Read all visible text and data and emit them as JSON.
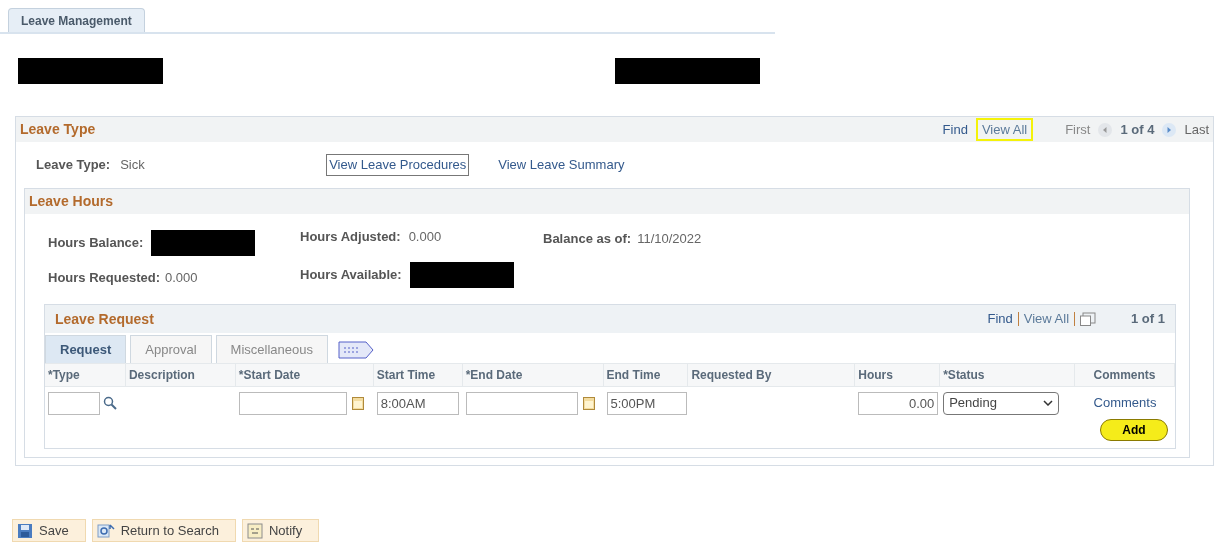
{
  "page_tab": {
    "label": "Leave Management",
    "selected": true
  },
  "leave_type_panel": {
    "title": "Leave Type",
    "nav": {
      "find": "Find",
      "view_all": {
        "label": "View All",
        "highlighted": true
      },
      "first": "First",
      "position": "1 of 4",
      "last": "Last"
    },
    "fields": {
      "leave_type_label": "Leave Type:",
      "leave_type_value": "Sick"
    },
    "links": [
      {
        "label": "View Leave Procedures",
        "focused": true
      },
      {
        "label": "View Leave Summary",
        "focused": false
      }
    ]
  },
  "leave_hours_panel": {
    "title": "Leave Hours",
    "hours_balance_label": "Hours Balance:",
    "hours_requested_label": "Hours Requested:",
    "hours_requested": "0.000",
    "hours_adjusted_label": "Hours Adjusted:",
    "hours_adjusted": "0.000",
    "hours_available_label": "Hours Available:",
    "balance_as_of_label": "Balance as of:",
    "balance_as_of": "11/10/2022"
  },
  "leave_request": {
    "title": "Leave Request",
    "nav": {
      "find": "Find",
      "view_all": "View All",
      "position": "1 of 1"
    },
    "tabs": [
      {
        "label": "Request",
        "selected": true
      },
      {
        "label": "Approval",
        "selected": false
      },
      {
        "label": "Miscellaneous",
        "selected": false
      }
    ],
    "columns": [
      "*Type",
      "Description",
      "*Start Date",
      "Start Time",
      "*End Date",
      "End Time",
      "Requested By",
      "Hours",
      "*Status",
      "Comments"
    ],
    "row": {
      "start_time": "8:00AM",
      "end_time": "5:00PM",
      "hours": "0.00",
      "status": "Pending",
      "comments": "Comments"
    },
    "add_button": "Add"
  },
  "toolbar": [
    {
      "label": "Save",
      "kind": "save"
    },
    {
      "label": "Return to Search",
      "kind": "search"
    },
    {
      "label": "Notify",
      "kind": "notify"
    }
  ]
}
